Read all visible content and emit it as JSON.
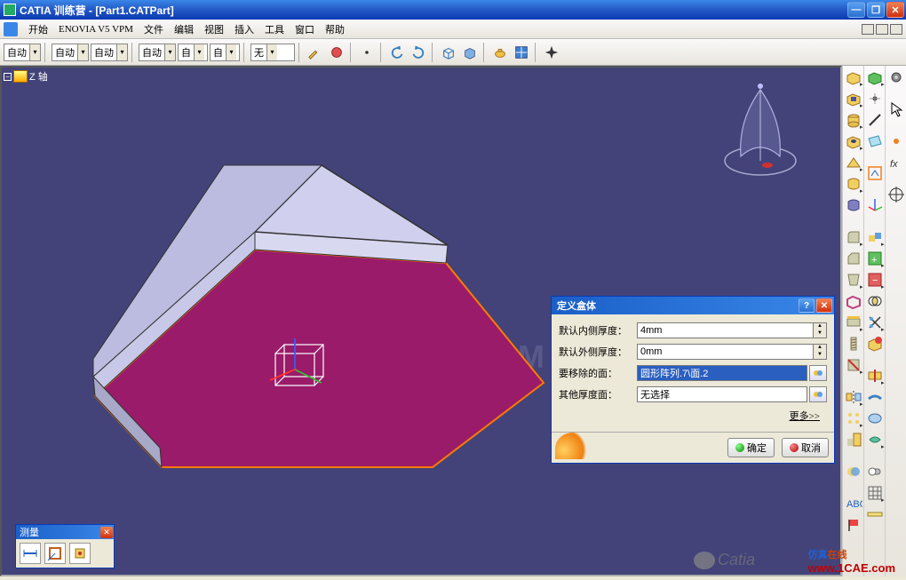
{
  "titlebar": {
    "title": "CATIA 训练营 - [Part1.CATPart]"
  },
  "menubar": {
    "start": "开始",
    "items": [
      "ENOVIA V5 VPM",
      "文件",
      "编辑",
      "视图",
      "插入",
      "工具",
      "窗口",
      "帮助"
    ]
  },
  "toolbar": {
    "sel": [
      "自动",
      "自动",
      "自动",
      "自动",
      "自",
      "自",
      "无"
    ]
  },
  "tree": {
    "axis": "Z 轴"
  },
  "dialog": {
    "title": "定义盒体",
    "rows": {
      "inner_label": "默认内侧厚度：",
      "inner_value": "4mm",
      "outer_label": "默认外侧厚度：",
      "outer_value": "0mm",
      "remove_label": "要移除的面：",
      "remove_value": "圆形阵列.7\\面.2",
      "other_label": "其他厚度面：",
      "other_value": "无选择"
    },
    "more": "更多>>",
    "ok": "确定",
    "cancel": "取消"
  },
  "palette": {
    "title": "测量"
  },
  "watermarks": {
    "center": "1CAE.COM",
    "wechat": "Catia",
    "site_a": "仿真",
    "site_b": "在线",
    "site_url": "www.1CAE.com"
  }
}
